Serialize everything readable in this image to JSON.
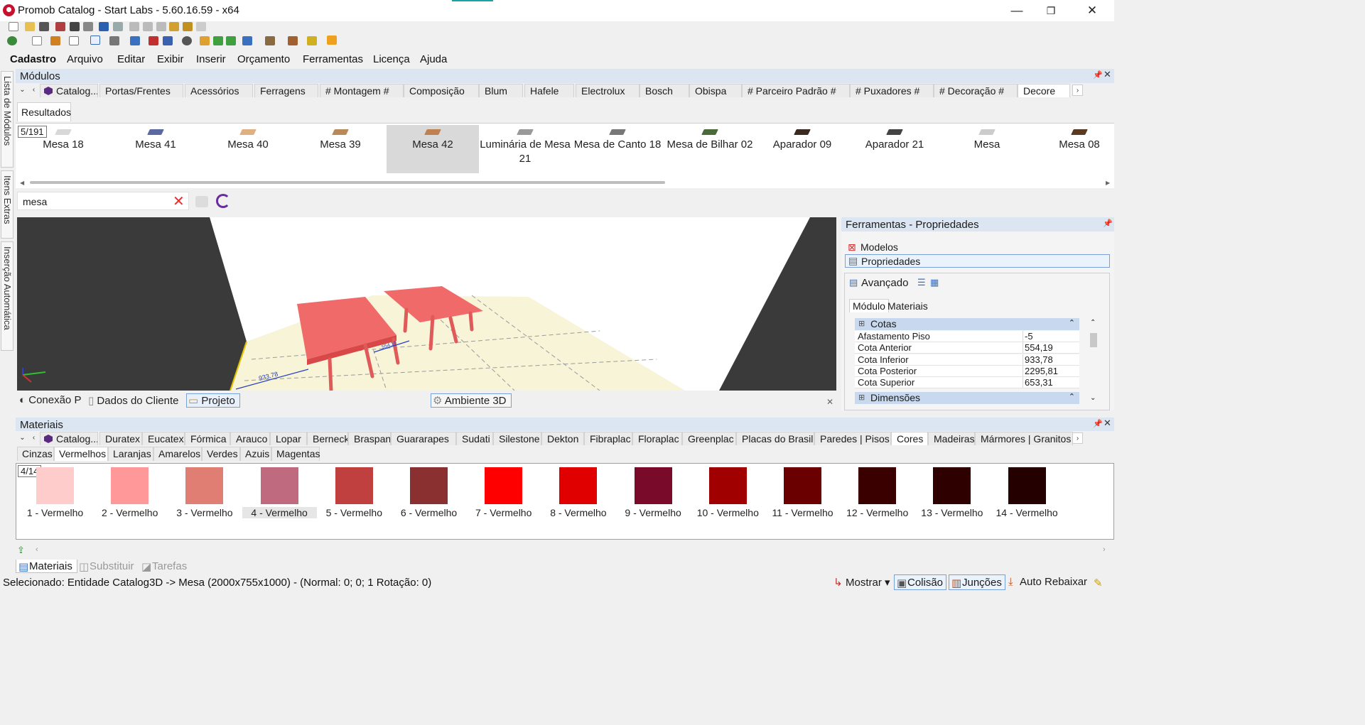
{
  "window": {
    "title": "Promob Catalog - Start Labs - 5.60.16.59 - x64",
    "minimize": "—",
    "restore": "❐",
    "close": "✕"
  },
  "menu": [
    "Cadastro",
    "Arquivo",
    "Editar",
    "Exibir",
    "Inserir",
    "Orçamento",
    "Ferramentas",
    "Licença",
    "Ajuda"
  ],
  "side_tabs": [
    "Lista de Módulos",
    "Itens Extras",
    "Inserção Automática"
  ],
  "modules": {
    "title": "Módulos",
    "categories": [
      "Catalog...",
      "Portas/Frentes",
      "Acessórios",
      "Ferragens",
      "# Montagem #",
      "Composição",
      "Blum",
      "Hafele",
      "Electrolux",
      "Bosch",
      "Obispa",
      "# Parceiro Padrão #",
      "# Puxadores #",
      "# Decoração #",
      "Decore"
    ],
    "results_tab": "Resultados",
    "count": "5/191",
    "items": [
      {
        "label": "Mesa 18",
        "color": "#d8d8d8"
      },
      {
        "label": "Mesa 41",
        "color": "#5a6aa0"
      },
      {
        "label": "Mesa 40",
        "color": "#e0b080"
      },
      {
        "label": "Mesa 39",
        "color": "#b88a5a"
      },
      {
        "label": "Mesa 42",
        "color": "#c08050"
      },
      {
        "label": "Luminária de Mesa 21",
        "color": "#999999"
      },
      {
        "label": "Mesa de Canto 18",
        "color": "#777777"
      },
      {
        "label": "Mesa de Bilhar 02",
        "color": "#4a6a3a"
      },
      {
        "label": "Aparador 09",
        "color": "#3a2a20"
      },
      {
        "label": "Aparador 21",
        "color": "#444444"
      },
      {
        "label": "Mesa",
        "color": "#cccccc"
      },
      {
        "label": "Mesa 08",
        "color": "#5a3a20"
      }
    ],
    "selected_index": 4
  },
  "search": {
    "value": "mesa"
  },
  "viewport": {
    "dim_a": "933,78",
    "dim_b": "554,19"
  },
  "project_tabs": [
    "Conexão P",
    "Dados do Cliente",
    "Projeto",
    "Ambiente 3D"
  ],
  "properties": {
    "title": "Ferramentas - Propriedades",
    "modelos": "Modelos",
    "propriedades": "Propriedades",
    "avancado": "Avançado",
    "tabs": [
      "Módulo",
      "Materiais"
    ],
    "group_cotas": "Cotas",
    "group_dimensoes": "Dimensões",
    "rows": [
      {
        "key": "Afastamento Piso",
        "value": "-5"
      },
      {
        "key": "Cota Anterior",
        "value": "554,19"
      },
      {
        "key": "Cota Inferior",
        "value": "933,78"
      },
      {
        "key": "Cota Posterior",
        "value": "2295,81"
      },
      {
        "key": "Cota Superior",
        "value": "653,31"
      }
    ]
  },
  "materials": {
    "title": "Materiais",
    "categories": [
      "Catalog...",
      "Duratex",
      "Eucatex",
      "Fórmica",
      "Arauco",
      "Lopar",
      "Berneck",
      "Braspan",
      "Guararapes",
      "Sudati",
      "Silestone",
      "Dekton",
      "Fibraplac",
      "Floraplac",
      "Greenplac",
      "Placas do Brasil",
      "Paredes | Pisos",
      "Cores",
      "Madeiras",
      "Mármores | Granitos"
    ],
    "active_category": "Cores",
    "subcategories": [
      "Cinzas",
      "Vermelhos",
      "Laranjas",
      "Amarelos",
      "Verdes",
      "Azuis",
      "Magentas"
    ],
    "active_sub": "Vermelhos",
    "count": "4/14",
    "colors": [
      {
        "label": "1 - Vermelho",
        "hex": "#ffcccc"
      },
      {
        "label": "2 - Vermelho",
        "hex": "#ff9999"
      },
      {
        "label": "3 - Vermelho",
        "hex": "#e07e74"
      },
      {
        "label": "4 - Vermelho",
        "hex": "#c06a80"
      },
      {
        "label": "5 - Vermelho",
        "hex": "#c04040"
      },
      {
        "label": "6 - Vermelho",
        "hex": "#8a3030"
      },
      {
        "label": "7 - Vermelho",
        "hex": "#ff0000"
      },
      {
        "label": "8 - Vermelho",
        "hex": "#e00000"
      },
      {
        "label": "9 - Vermelho",
        "hex": "#7a0a2a"
      },
      {
        "label": "10 - Vermelho",
        "hex": "#a00000"
      },
      {
        "label": "11 - Vermelho",
        "hex": "#6a0000"
      },
      {
        "label": "12 - Vermelho",
        "hex": "#3a0000"
      },
      {
        "label": "13 - Vermelho",
        "hex": "#2e0000"
      },
      {
        "label": "14 - Vermelho",
        "hex": "#240000"
      }
    ],
    "selected_index": 3,
    "bottom_tabs": [
      "Materiais",
      "Substituir",
      "Tarefas"
    ]
  },
  "status": {
    "text": "Selecionado: Entidade Catalog3D -> Mesa (2000x755x1000) - (Normal: 0; 0; 1 Rotação: 0)",
    "mostrar": "Mostrar",
    "colisao": "Colisão",
    "juncoes": "Junções",
    "auto_rebaixar": "Auto Rebaixar"
  }
}
